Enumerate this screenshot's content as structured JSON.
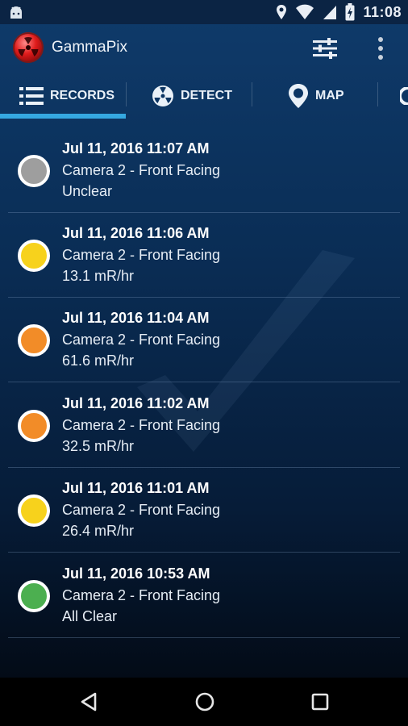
{
  "status_bar": {
    "time": "11:08"
  },
  "app_bar": {
    "title": "GammaPix"
  },
  "tabs": [
    {
      "label": "RECORDS",
      "icon": "list-icon",
      "selected": true
    },
    {
      "label": "DETECT",
      "icon": "radiation-icon",
      "selected": false
    },
    {
      "label": "MAP",
      "icon": "map-pin-icon",
      "selected": false
    }
  ],
  "colors": {
    "accent": "#35a8e0",
    "status_gray": "#9e9e9e",
    "status_yellow": "#f7d21c",
    "status_orange": "#f28c28",
    "status_green": "#4caf50"
  },
  "records": [
    {
      "date": "Jul 11, 2016 11:07 AM",
      "camera": "Camera 2  - Front Facing",
      "value": "Unclear",
      "status_color": "#9e9e9e"
    },
    {
      "date": "Jul 11, 2016 11:06 AM",
      "camera": "Camera 2  - Front Facing",
      "value": "13.1 mR/hr",
      "status_color": "#f7d21c"
    },
    {
      "date": "Jul 11, 2016 11:04 AM",
      "camera": "Camera 2  - Front Facing",
      "value": "61.6 mR/hr",
      "status_color": "#f28c28"
    },
    {
      "date": "Jul 11, 2016 11:02 AM",
      "camera": "Camera 2  - Front Facing",
      "value": "32.5 mR/hr",
      "status_color": "#f28c28"
    },
    {
      "date": "Jul 11, 2016 11:01 AM",
      "camera": "Camera 2  - Front Facing",
      "value": "26.4 mR/hr",
      "status_color": "#f7d21c"
    },
    {
      "date": "Jul 11, 2016 10:53 AM",
      "camera": "Camera 2  - Front Facing",
      "value": "All Clear",
      "status_color": "#4caf50"
    }
  ]
}
